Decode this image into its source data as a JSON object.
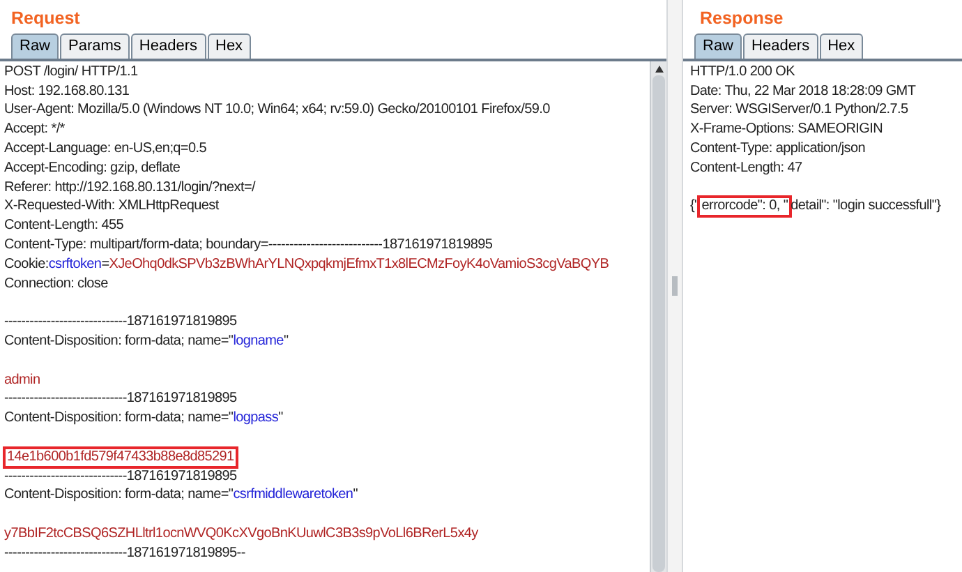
{
  "request": {
    "title": "Request",
    "tabs": [
      {
        "label": "Raw",
        "selected": true
      },
      {
        "label": "Params",
        "selected": false
      },
      {
        "label": "Headers",
        "selected": false
      },
      {
        "label": "Hex",
        "selected": false
      }
    ],
    "lines": [
      {
        "kind": "text",
        "segments": [
          {
            "text": "POST /login/ HTTP/1.1",
            "kind": "plain",
            "boxed": false
          }
        ]
      },
      {
        "kind": "text",
        "segments": [
          {
            "text": "Host: 192.168.80.131",
            "kind": "plain",
            "boxed": false
          }
        ]
      },
      {
        "kind": "text",
        "segments": [
          {
            "text": "User-Agent: Mozilla/5.0 (Windows NT 10.0; Win64; x64; rv:59.0) Gecko/20100101 Firefox/59.0",
            "kind": "plain",
            "boxed": false
          }
        ]
      },
      {
        "kind": "text",
        "segments": [
          {
            "text": "Accept: */*",
            "kind": "plain",
            "boxed": false
          }
        ]
      },
      {
        "kind": "text",
        "segments": [
          {
            "text": "Accept-Language: en-US,en;q=0.5",
            "kind": "plain",
            "boxed": false
          }
        ]
      },
      {
        "kind": "text",
        "segments": [
          {
            "text": "Accept-Encoding: gzip, deflate",
            "kind": "plain",
            "boxed": false
          }
        ]
      },
      {
        "kind": "text",
        "segments": [
          {
            "text": "Referer: http://192.168.80.131/login/?next=/",
            "kind": "plain",
            "boxed": false
          }
        ]
      },
      {
        "kind": "text",
        "segments": [
          {
            "text": "X-Requested-With: XMLHttpRequest",
            "kind": "plain",
            "boxed": false
          }
        ]
      },
      {
        "kind": "text",
        "segments": [
          {
            "text": "Content-Length: 455",
            "kind": "plain",
            "boxed": false
          }
        ]
      },
      {
        "kind": "text",
        "segments": [
          {
            "text": "Content-Type: multipart/form-data; boundary=---------------------------187161971819895",
            "kind": "plain",
            "boxed": false
          }
        ]
      },
      {
        "kind": "text",
        "segments": [
          {
            "text": "Cookie: ",
            "kind": "plain",
            "boxed": false
          },
          {
            "text": "csrftoken",
            "kind": "name",
            "boxed": false
          },
          {
            "text": "=",
            "kind": "plain",
            "boxed": false
          },
          {
            "text": "XJeOhq0dkSPVb3zBWhArYLNQxpqkmjEfmxT1x8lECMzFoyK4oVamioS3cgVaBQYB",
            "kind": "value",
            "boxed": false
          }
        ]
      },
      {
        "kind": "text",
        "segments": [
          {
            "text": "Connection: close",
            "kind": "plain",
            "boxed": false
          }
        ]
      },
      {
        "kind": "blank"
      },
      {
        "kind": "text",
        "segments": [
          {
            "text": "-----------------------------187161971819895",
            "kind": "plain",
            "boxed": false
          }
        ]
      },
      {
        "kind": "text",
        "segments": [
          {
            "text": "Content-Disposition: form-data; name=\"",
            "kind": "plain",
            "boxed": false
          },
          {
            "text": "logname",
            "kind": "name",
            "boxed": false
          },
          {
            "text": "\"",
            "kind": "plain",
            "boxed": false
          }
        ]
      },
      {
        "kind": "blank"
      },
      {
        "kind": "text",
        "segments": [
          {
            "text": "admin",
            "kind": "value",
            "boxed": false
          }
        ]
      },
      {
        "kind": "text",
        "segments": [
          {
            "text": "-----------------------------187161971819895",
            "kind": "plain",
            "boxed": false
          }
        ]
      },
      {
        "kind": "text",
        "segments": [
          {
            "text": "Content-Disposition: form-data; name=\"",
            "kind": "plain",
            "boxed": false
          },
          {
            "text": "logpass",
            "kind": "name",
            "boxed": false
          },
          {
            "text": "\"",
            "kind": "plain",
            "boxed": false
          }
        ]
      },
      {
        "kind": "blank"
      },
      {
        "kind": "text",
        "segments": [
          {
            "text": "14e1b600b1fd579f47433b88e8d85291",
            "kind": "value",
            "boxed": true
          }
        ]
      },
      {
        "kind": "text",
        "segments": [
          {
            "text": "-----------------------------187161971819895",
            "kind": "plain",
            "boxed": false
          }
        ]
      },
      {
        "kind": "text",
        "segments": [
          {
            "text": "Content-Disposition: form-data; name=\"",
            "kind": "plain",
            "boxed": false
          },
          {
            "text": "csrfmiddlewaretoken",
            "kind": "name",
            "boxed": false
          },
          {
            "text": "\"",
            "kind": "plain",
            "boxed": false
          }
        ]
      },
      {
        "kind": "blank"
      },
      {
        "kind": "text",
        "segments": [
          {
            "text": "y7BbIF2tcCBSQ6SZHLltrl1ocnWVQ0KcXVgoBnKUuwlC3B3s9pVoLl6BRerL5x4y",
            "kind": "value",
            "boxed": false
          }
        ]
      },
      {
        "kind": "text",
        "segments": [
          {
            "text": "-----------------------------187161971819895--",
            "kind": "plain",
            "boxed": false
          }
        ]
      }
    ]
  },
  "response": {
    "title": "Response",
    "tabs": [
      {
        "label": "Raw",
        "selected": true
      },
      {
        "label": "Headers",
        "selected": false
      },
      {
        "label": "Hex",
        "selected": false
      }
    ],
    "lines": [
      {
        "kind": "text",
        "segments": [
          {
            "text": "HTTP/1.0 200 OK",
            "kind": "plain",
            "boxed": false
          }
        ]
      },
      {
        "kind": "text",
        "segments": [
          {
            "text": "Date: Thu, 22 Mar 2018 18:28:09 GMT",
            "kind": "plain",
            "boxed": false
          }
        ]
      },
      {
        "kind": "text",
        "segments": [
          {
            "text": "Server: WSGIServer/0.1 Python/2.7.5",
            "kind": "plain",
            "boxed": false
          }
        ]
      },
      {
        "kind": "text",
        "segments": [
          {
            "text": "X-Frame-Options: SAMEORIGIN",
            "kind": "plain",
            "boxed": false
          }
        ]
      },
      {
        "kind": "text",
        "segments": [
          {
            "text": "Content-Type: application/json",
            "kind": "plain",
            "boxed": false
          }
        ]
      },
      {
        "kind": "text",
        "segments": [
          {
            "text": "Content-Length: 47",
            "kind": "plain",
            "boxed": false
          }
        ]
      },
      {
        "kind": "blank"
      },
      {
        "kind": "text",
        "segments": [
          {
            "text": "{\"",
            "kind": "plain",
            "boxed": false
          },
          {
            "text": "errorcode\": 0, \"",
            "kind": "plain",
            "boxed": true
          },
          {
            "text": "detail\": \"login successfull\"}",
            "kind": "plain",
            "boxed": false
          }
        ]
      }
    ]
  }
}
